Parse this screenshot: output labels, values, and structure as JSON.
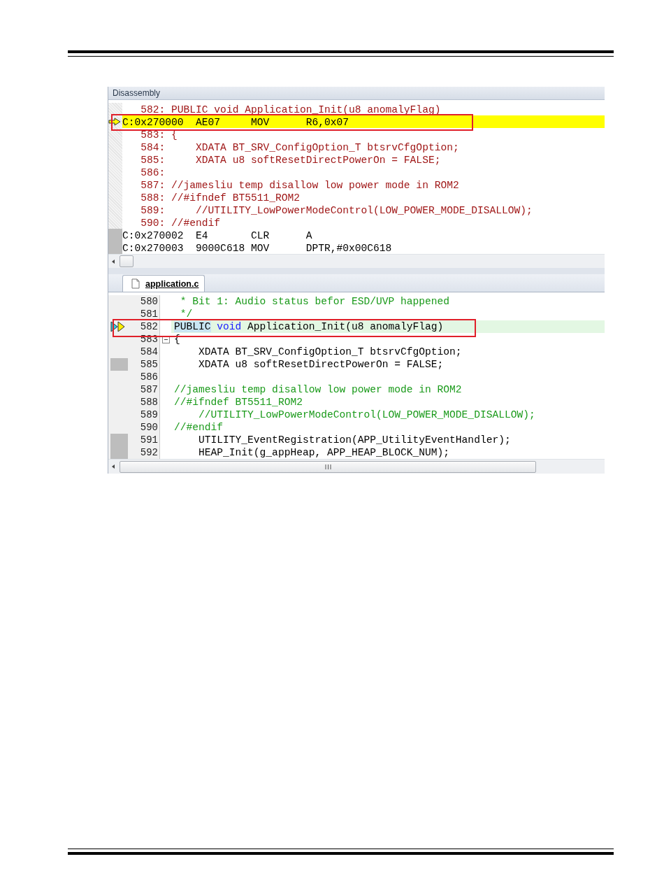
{
  "disassembly": {
    "title": "Disassembly",
    "rows": [
      {
        "kind": "source",
        "text": "   582: PUBLIC void Application_Init(u8 anomalyFlag)",
        "current": false,
        "marked": false
      },
      {
        "kind": "asm",
        "text": "C:0x270000  AE07     MOV      R6,0x07",
        "current": true,
        "marked": false
      },
      {
        "kind": "source",
        "text": "   583: {",
        "current": false,
        "marked": false
      },
      {
        "kind": "source",
        "text": "   584:     XDATA BT_SRV_ConfigOption_T btsrvCfgOption;",
        "current": false,
        "marked": false
      },
      {
        "kind": "source",
        "text": "   585:     XDATA u8 softResetDirectPowerOn = FALSE;",
        "current": false,
        "marked": false
      },
      {
        "kind": "source",
        "text": "   586:",
        "current": false,
        "marked": false
      },
      {
        "kind": "source",
        "text": "   587: //jamesliu temp disallow low power mode in ROM2",
        "current": false,
        "marked": false
      },
      {
        "kind": "source",
        "text": "   588: //#ifndef BT5511_ROM2",
        "current": false,
        "marked": false
      },
      {
        "kind": "source",
        "text": "   589:     //UTILITY_LowPowerModeControl(LOW_POWER_MODE_DISALLOW);",
        "current": false,
        "marked": false
      },
      {
        "kind": "source",
        "text": "   590: //#endif",
        "current": false,
        "marked": false
      },
      {
        "kind": "asm",
        "text": "C:0x270002  E4       CLR      A",
        "current": false,
        "marked": true
      },
      {
        "kind": "asm",
        "text": "C:0x270003  9000C618 MOV      DPTR,#0x00C618",
        "current": false,
        "marked": true
      }
    ]
  },
  "editor": {
    "tabs": [
      {
        "label": "application.c",
        "selected": true
      }
    ],
    "lines": [
      {
        "number": "580",
        "current": false,
        "marked": false,
        "fold": false,
        "segments": [
          {
            "kind": "comment",
            "text": " * Bit 1: Audio status befor ESD/UVP happened"
          }
        ]
      },
      {
        "number": "581",
        "current": false,
        "marked": false,
        "fold": false,
        "segments": [
          {
            "kind": "comment",
            "text": " */"
          }
        ]
      },
      {
        "number": "582",
        "current": true,
        "marked": false,
        "fold": false,
        "segments": [
          {
            "kind": "match",
            "text": "PUBLIC"
          },
          {
            "kind": "keyword",
            "text": " void"
          },
          {
            "kind": "code",
            "text": " Application_Init(u8 anomalyFlag)"
          }
        ]
      },
      {
        "number": "583",
        "current": false,
        "marked": false,
        "fold": true,
        "segments": [
          {
            "kind": "code",
            "text": "{"
          }
        ]
      },
      {
        "number": "584",
        "current": false,
        "marked": false,
        "fold": false,
        "segments": [
          {
            "kind": "code",
            "text": "    XDATA BT_SRV_ConfigOption_T btsrvCfgOption;"
          }
        ]
      },
      {
        "number": "585",
        "current": false,
        "marked": true,
        "fold": false,
        "segments": [
          {
            "kind": "code",
            "text": "    XDATA u8 softResetDirectPowerOn = FALSE;"
          }
        ]
      },
      {
        "number": "586",
        "current": false,
        "marked": false,
        "fold": false
      },
      {
        "number": "587",
        "current": false,
        "marked": false,
        "fold": false,
        "segments": [
          {
            "kind": "comment",
            "text": "//jamesliu temp disallow low power mode in ROM2"
          }
        ]
      },
      {
        "number": "588",
        "current": false,
        "marked": false,
        "fold": false,
        "segments": [
          {
            "kind": "comment",
            "text": "//#ifndef BT5511_ROM2"
          }
        ]
      },
      {
        "number": "589",
        "current": false,
        "marked": false,
        "fold": false,
        "segments": [
          {
            "kind": "comment",
            "text": "    //UTILITY_LowPowerModeControl(LOW_POWER_MODE_DISALLOW);"
          }
        ]
      },
      {
        "number": "590",
        "current": false,
        "marked": false,
        "fold": false,
        "segments": [
          {
            "kind": "comment",
            "text": "//#endif"
          }
        ]
      },
      {
        "number": "591",
        "current": false,
        "marked": true,
        "fold": false,
        "segments": [
          {
            "kind": "code",
            "text": "    UTILITY_EventRegistration(APP_UtilityEventHandler);"
          }
        ]
      },
      {
        "number": "592",
        "current": false,
        "marked": true,
        "fold": false,
        "segments": [
          {
            "kind": "code",
            "text": "    HEAP_Init(g_appHeap, APP_HEAP_BLOCK_NUM);"
          }
        ]
      }
    ]
  }
}
